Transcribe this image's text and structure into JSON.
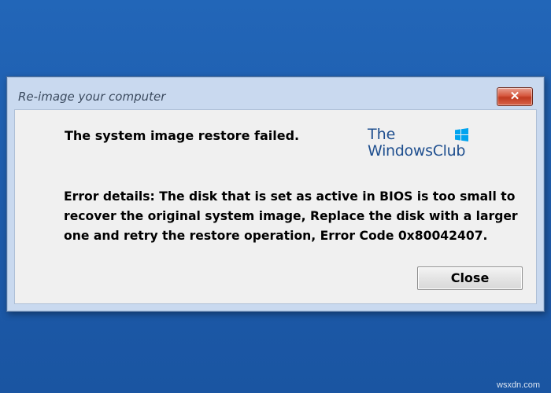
{
  "window": {
    "title": "Re-image your computer",
    "close_glyph": "✕"
  },
  "dialog": {
    "headline": "The system image restore failed.",
    "details": "Error details: The disk that is set as active in BIOS is too small to recover the original system image, Replace the disk with a larger one and retry the restore operation, Error Code 0x80042407.",
    "close_button": "Close"
  },
  "brand": {
    "line1": "The",
    "line2": "WindowsClub",
    "logo_icon": "windows-logo-icon"
  },
  "watermark": "wsxdn.com",
  "colors": {
    "desktop": "#1f5fae",
    "window_frame": "#c9d9ef",
    "client_bg": "#f0f0f0",
    "close_red": "#c9452b",
    "brand_blue": "#1f4f8f",
    "logo_blue": "#00a4ef"
  }
}
